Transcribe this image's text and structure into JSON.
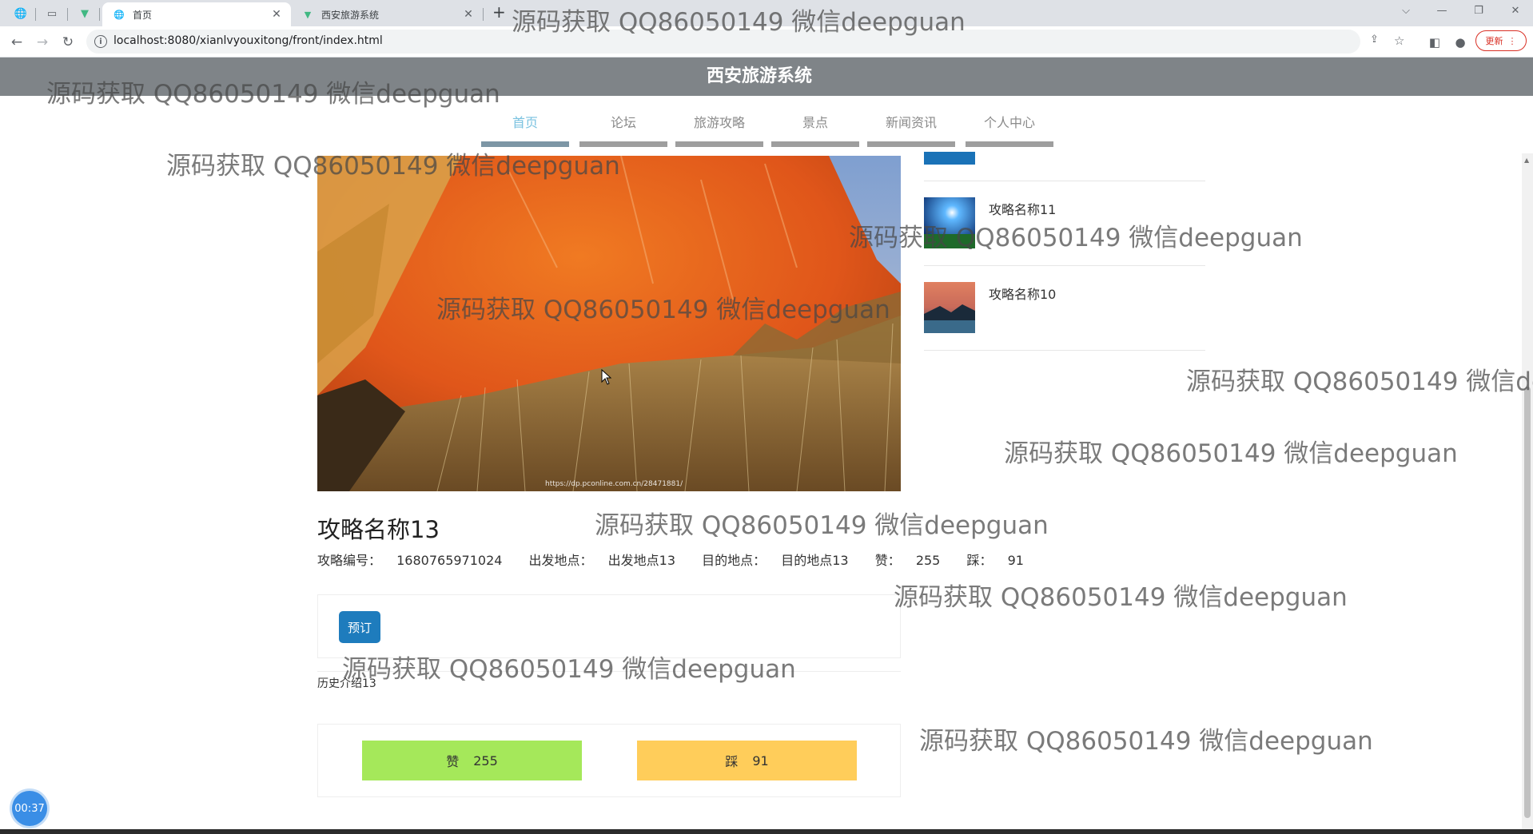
{
  "browser": {
    "tabs": [
      {
        "title": "首页",
        "icon": "globe-icon",
        "active": true
      },
      {
        "title": "西安旅游系统",
        "icon": "vue-logo-icon",
        "active": false
      }
    ],
    "url": "localhost:8080/xianlvyouxitong/front/index.html",
    "update_label": "更新"
  },
  "site": {
    "title": "西安旅游系统",
    "nav": [
      {
        "label": "首页",
        "active": true
      },
      {
        "label": "论坛",
        "active": false
      },
      {
        "label": "旅游攻略",
        "active": false
      },
      {
        "label": "景点",
        "active": false
      },
      {
        "label": "新闻资讯",
        "active": false
      },
      {
        "label": "个人中心",
        "active": false
      }
    ]
  },
  "hero": {
    "caption": "https://dp.pconline.com.cn/28471881/"
  },
  "sidebar": {
    "items": [
      {
        "title": "攻略名称11"
      },
      {
        "title": "攻略名称10"
      }
    ]
  },
  "article": {
    "title": "攻略名称13",
    "meta": {
      "id_label": "攻略编号：",
      "id_value": "1680765971024",
      "from_label": "出发地点：",
      "from_value": "出发地点13",
      "to_label": "目的地点：",
      "to_value": "目的地点13",
      "like_label": "赞：",
      "like_value": "255",
      "dislike_label": "踩：",
      "dislike_value": "91"
    },
    "book_label": "预订",
    "history": "历史介绍13",
    "like_button": {
      "label": "赞",
      "count": "255"
    },
    "dislike_button": {
      "label": "踩",
      "count": "91"
    }
  },
  "recorder": {
    "timer": "00:37"
  },
  "watermark": {
    "text": "源码获取 QQ86050149 微信deepguan"
  },
  "colors": {
    "header_bg": "#7f8488",
    "nav_active": "#7ac2e0",
    "book_button": "#1e7cbd",
    "like_button": "#a5e85a",
    "dislike_button": "#ffcd5a"
  }
}
